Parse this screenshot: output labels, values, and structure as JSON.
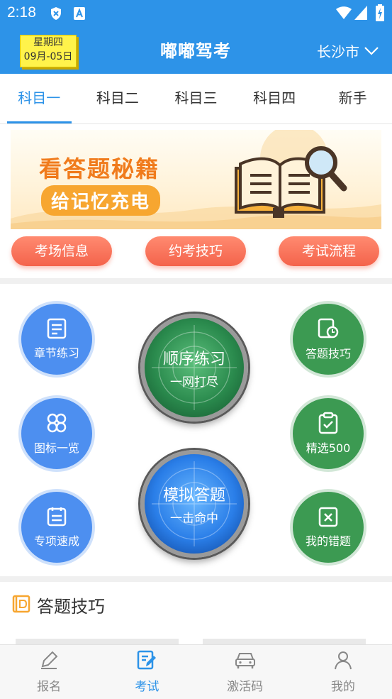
{
  "status": {
    "time": "2:18"
  },
  "header": {
    "weekday": "星期四",
    "date": "09月-05日",
    "title": "嘟嘟驾考",
    "city": "长沙市"
  },
  "tabs": [
    "科目一",
    "科目二",
    "科目三",
    "科目四",
    "新手"
  ],
  "banner": {
    "line1": "看答题秘籍",
    "line2": "给记忆充电"
  },
  "quick_buttons": [
    "考场信息",
    "约考技巧",
    "考试流程"
  ],
  "practice": {
    "chapter": "章节练习",
    "icons": "图标一览",
    "special": "专项速成",
    "sequential_title": "顺序练习",
    "sequential_sub": "一网打尽",
    "mock_title": "模拟答题",
    "mock_sub": "一击命中",
    "tips": "答题技巧",
    "selected": "精选500",
    "mistakes": "我的错题"
  },
  "tips_section": {
    "title": "答题技巧"
  },
  "bottom_nav": [
    "报名",
    "考试",
    "激活码",
    "我的"
  ],
  "colors": {
    "brand": "#2d93e8",
    "green": "#3c9a52",
    "blue_circle": "#4d8ff0",
    "coral": "#f4634b"
  }
}
